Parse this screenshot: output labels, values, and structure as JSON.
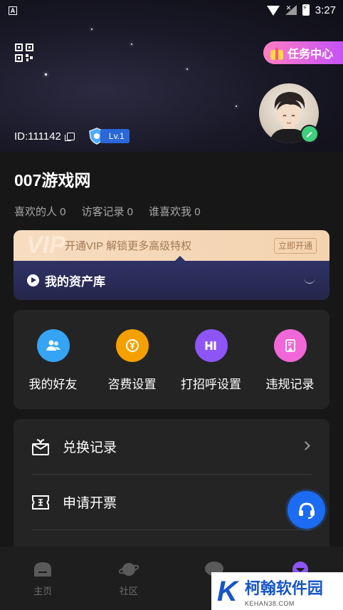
{
  "status_bar": {
    "notification": "A",
    "time": "3:27"
  },
  "header": {
    "task_center_label": "任务中心",
    "user_id": "ID:111142",
    "level": "Lv.1"
  },
  "profile": {
    "username": "007游戏网",
    "stats": [
      {
        "label": "喜欢的人 0"
      },
      {
        "label": "访客记录 0"
      },
      {
        "label": "谁喜欢我 0"
      }
    ]
  },
  "vip": {
    "logo": "VIP",
    "promo_text": "开通VIP 解锁更多高级特权",
    "open_label": "立即开通",
    "assets_label": "我的资产库"
  },
  "actions": [
    {
      "label": "我的好友",
      "icon": "friends-icon",
      "color": "#35a4f4"
    },
    {
      "label": "咨费设置",
      "icon": "coin-icon",
      "color": "#f5a000"
    },
    {
      "label": "打招呼设置",
      "icon": "hi-icon",
      "color": "#8d55f6"
    },
    {
      "label": "违规记录",
      "icon": "report-icon",
      "color": "#f167d9"
    }
  ],
  "list": [
    {
      "label": "兑换记录",
      "icon": "gift-box-icon"
    },
    {
      "label": "申请开票",
      "icon": "ticket-icon"
    }
  ],
  "tabs": [
    {
      "label": "主页"
    },
    {
      "label": "社区"
    },
    {
      "label": ""
    },
    {
      "label": ""
    }
  ],
  "watermark": {
    "logo": "K",
    "title": "柯翰软件园",
    "subtitle": "KEHAN38.COM"
  }
}
